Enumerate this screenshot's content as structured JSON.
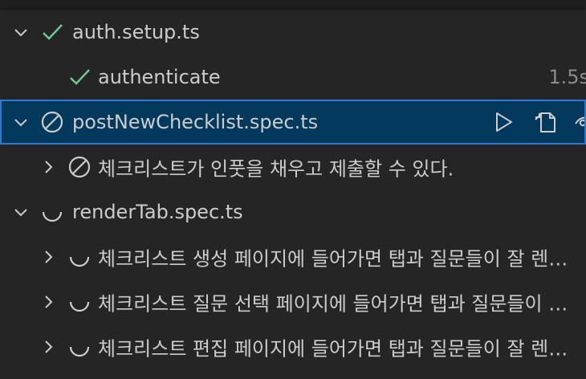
{
  "colors": {
    "pass": "#73c991",
    "icon": "#cccccc",
    "selected_bg": "#04395e",
    "selected_border": "#2b79d0",
    "duration": "#8b8b8b"
  },
  "tests": [
    {
      "label": "auth.setup.ts",
      "expanded": true,
      "status": "passed"
    },
    {
      "label": "authenticate",
      "status": "passed",
      "duration": "1.5s"
    },
    {
      "label": "postNewChecklist.spec.ts",
      "expanded": true,
      "status": "skipped",
      "selected": true
    },
    {
      "label": "체크리스트가 인풋을 채우고 제출할 수 있다.",
      "expanded": false,
      "status": "skipped"
    },
    {
      "label": "renderTab.spec.ts",
      "expanded": true,
      "status": "running"
    },
    {
      "label": "체크리스트 생성 페이지에 들어가면 탭과 질문들이 잘 렌더링된다.",
      "expanded": false,
      "status": "running"
    },
    {
      "label": "체크리스트 질문 선택 페이지에 들어가면 탭과 질문들이 잘 렌더링된다.",
      "expanded": false,
      "status": "running"
    },
    {
      "label": "체크리스트 편집 페이지에 들어가면 탭과 질문들이 잘 렌더링된다.",
      "expanded": false,
      "status": "running"
    }
  ],
  "actions": [
    {
      "icon": "run-test-icon"
    },
    {
      "icon": "go-to-file-icon"
    },
    {
      "icon": "watch-eye-icon"
    }
  ]
}
